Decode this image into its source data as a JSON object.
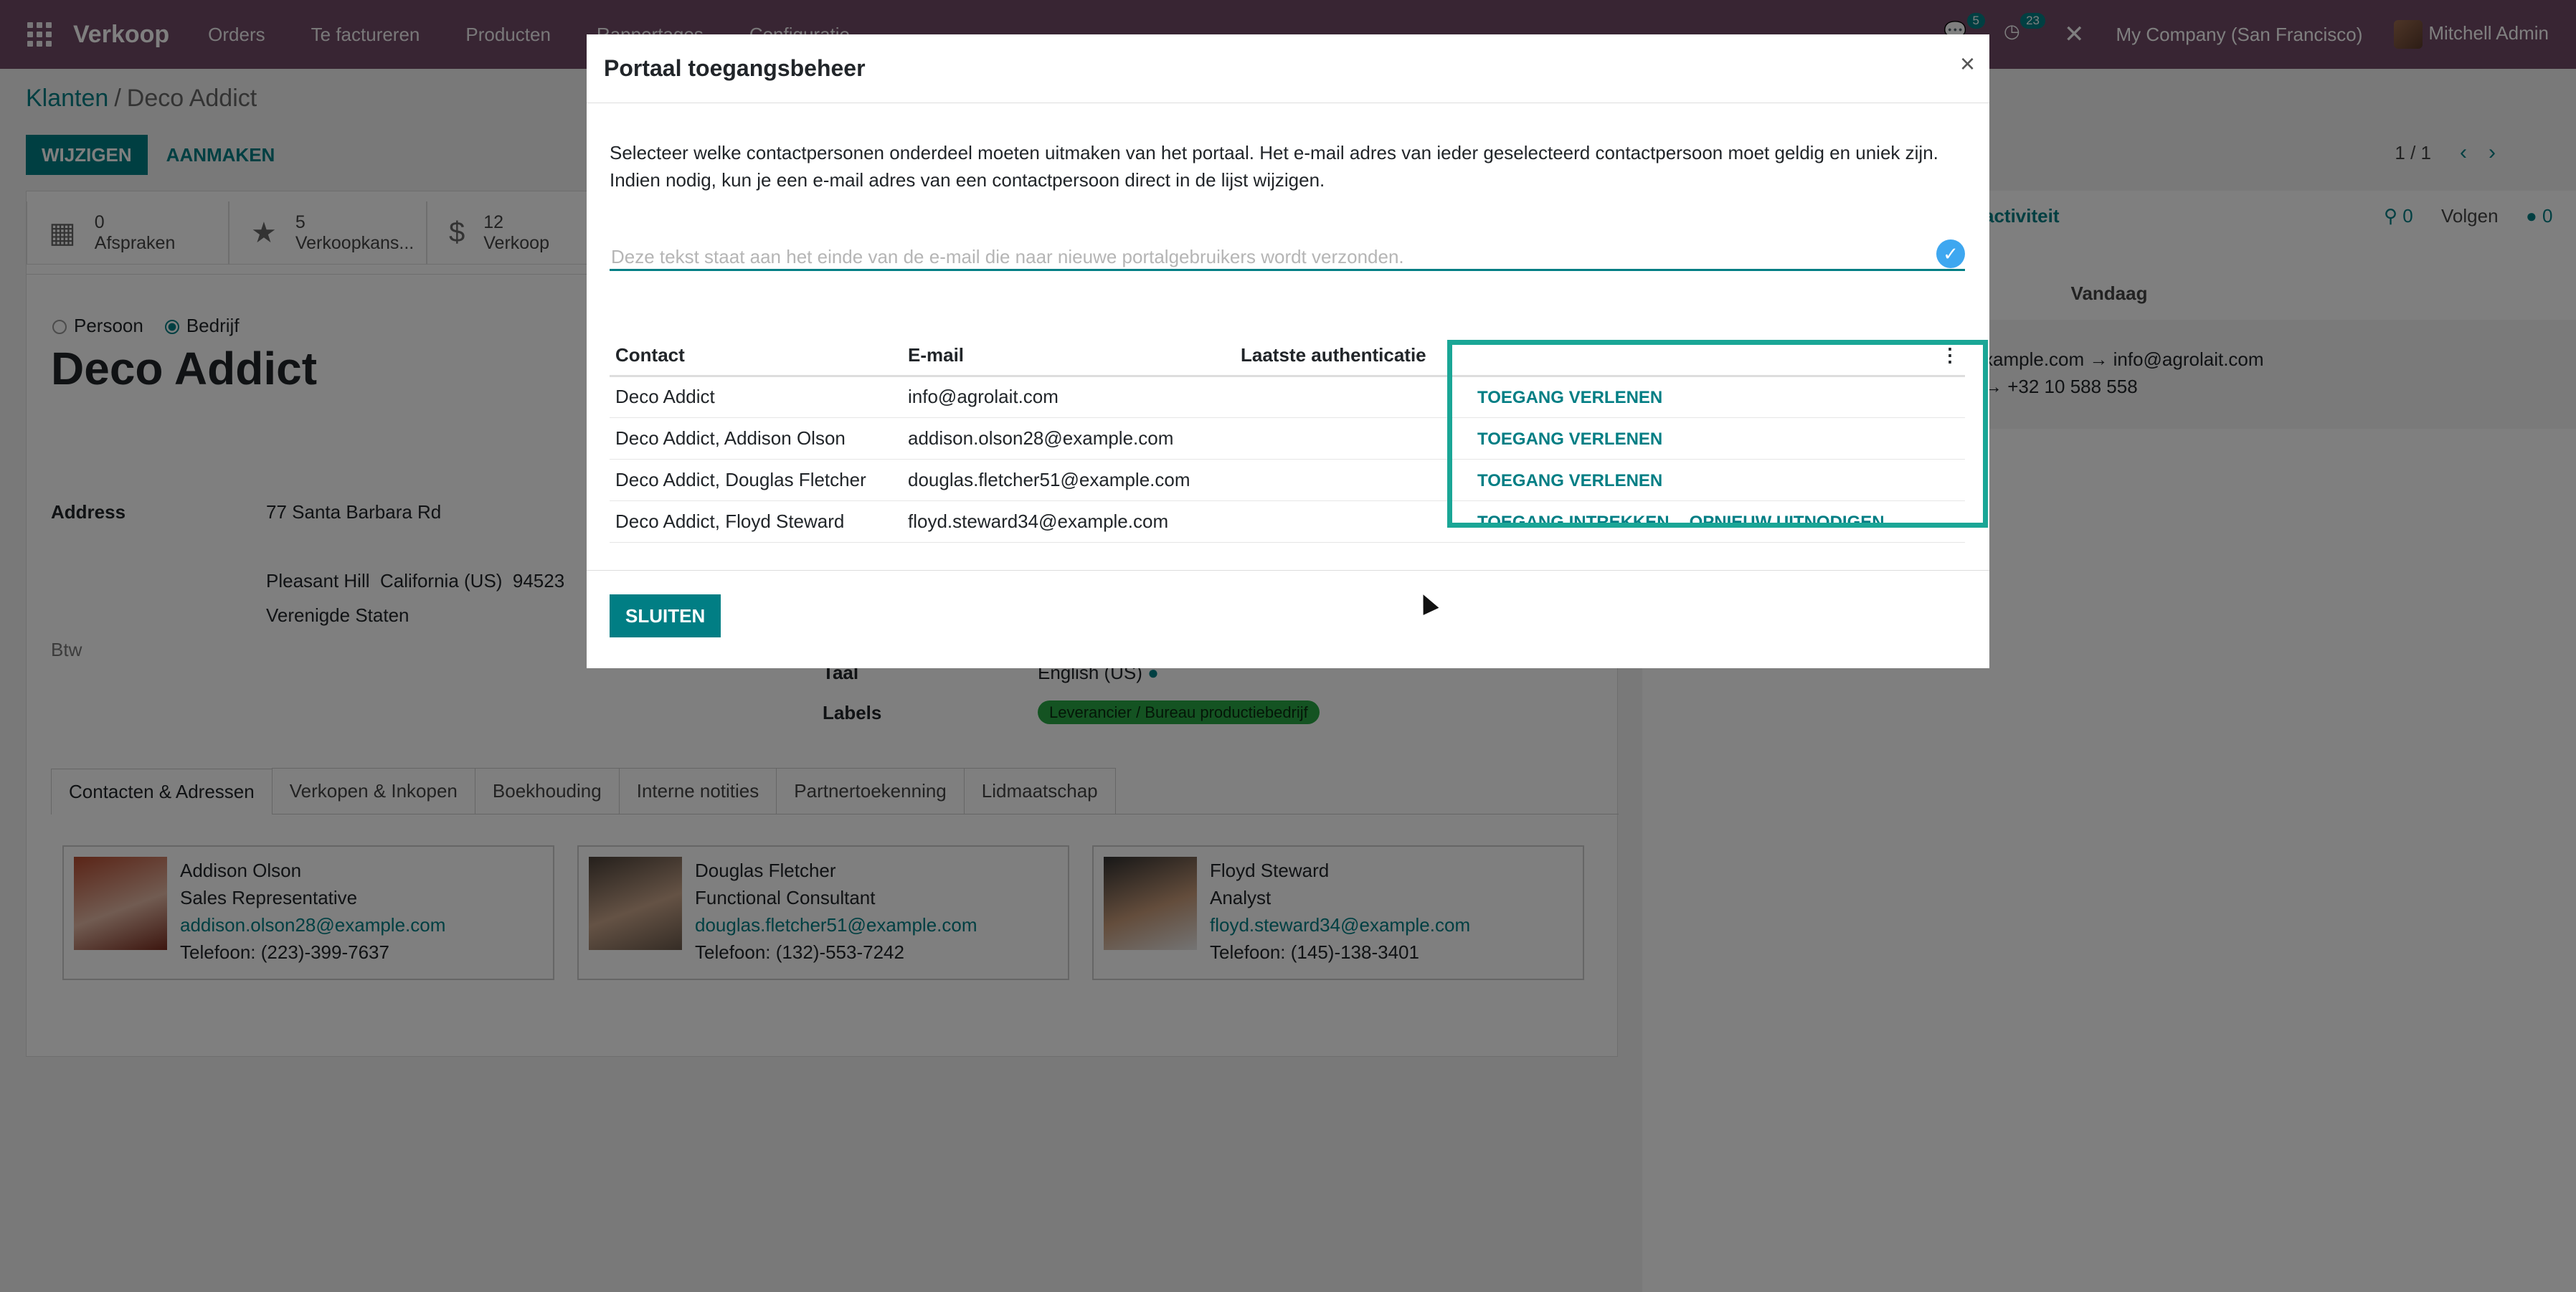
{
  "navbar": {
    "app_name": "Verkoop",
    "menus": [
      "Orders",
      "Te factureren",
      "Producten",
      "Rapportages",
      "Configuratie"
    ],
    "messages_count": "5",
    "activities_count": "23",
    "company": "My Company (San Francisco)",
    "user": "Mitchell Admin"
  },
  "breadcrumb": {
    "parent": "Klanten",
    "separator": "/",
    "current": "Deco Addict"
  },
  "control": {
    "edit_label": "WIJZIGEN",
    "create_label": "AANMAKEN",
    "pager": "1 / 1"
  },
  "stats": [
    {
      "icon": "calendar-icon",
      "value": "0",
      "label": "Afspraken"
    },
    {
      "icon": "star-icon",
      "value": "5",
      "label": "Verkoopkans..."
    },
    {
      "icon": "dollar-icon",
      "value": "12",
      "label": "Verkoop"
    }
  ],
  "form": {
    "type_person": "Persoon",
    "type_company": "Bedrijf",
    "name": "Deco Addict",
    "address_label": "Address",
    "street": "77 Santa Barbara Rd",
    "city_line": "Pleasant Hill  California (US)  94523",
    "country": "Verenigde Staten",
    "vat_label": "Btw",
    "language_label": "Taal",
    "language_value": "English (US)",
    "tags_label": "Labels",
    "tag": "Leverancier / Bureau productiebedrijf"
  },
  "tabs": [
    "Contacten & Adressen",
    "Verkopen & Inkopen",
    "Boekhouding",
    "Interne notities",
    "Partnertoekenning",
    "Lidmaatschap"
  ],
  "contacts": [
    {
      "name": "Addison Olson",
      "function": "Sales Representative",
      "email": "addison.olson28@example.com",
      "phone": "Telefoon: (223)-399-7637"
    },
    {
      "name": "Douglas Fletcher",
      "function": "Functional Consultant",
      "email": "douglas.fletcher51@example.com",
      "phone": "Telefoon: (132)-553-7242"
    },
    {
      "name": "Floyd Steward",
      "function": "Analyst",
      "email": "floyd.steward34@example.com",
      "phone": "Telefoon: (145)-138-3401"
    }
  ],
  "chatter": {
    "activity": "activiteit",
    "attachments": "0",
    "follow": "Volgen",
    "followers": "0",
    "today": "Vandaag",
    "msg_line1": "xample.com → info@agrolait.com",
    "msg_line2": "→ +32 10 588 558"
  },
  "modal": {
    "title": "Portaal toegangsbeheer",
    "intro_line1": "Selecteer welke contactpersonen onderdeel moeten uitmaken van het portaal. Het e-mail adres van ieder geselecteerd contactpersoon moet geldig en uniek zijn.",
    "intro_line2": "Indien nodig, kun je een e-mail adres van een contactpersoon direct in de lijst wijzigen.",
    "welcome_placeholder": "Deze tekst staat aan het einde van de e-mail die naar nieuwe portalgebruikers wordt verzonden.",
    "columns": {
      "contact": "Contact",
      "email": "E-mail",
      "last_auth": "Laatste authenticatie"
    },
    "rows": [
      {
        "contact": "Deco Addict",
        "email": "info@agrolait.com",
        "last_auth": "",
        "actions": [
          "TOEGANG VERLENEN"
        ]
      },
      {
        "contact": "Deco Addict, Addison Olson",
        "email": "addison.olson28@example.com",
        "last_auth": "",
        "actions": [
          "TOEGANG VERLENEN"
        ]
      },
      {
        "contact": "Deco Addict, Douglas Fletcher",
        "email": "douglas.fletcher51@example.com",
        "last_auth": "",
        "actions": [
          "TOEGANG VERLENEN"
        ]
      },
      {
        "contact": "Deco Addict, Floyd Steward",
        "email": "floyd.steward34@example.com",
        "last_auth": "",
        "actions": [
          "TOEGANG INTREKKEN",
          "OPNIEUW UITNODIGEN"
        ]
      }
    ],
    "close_label": "SLUITEN"
  },
  "colors": {
    "brand": "#714b67",
    "accent": "#017e84",
    "highlight": "#1aa696"
  }
}
